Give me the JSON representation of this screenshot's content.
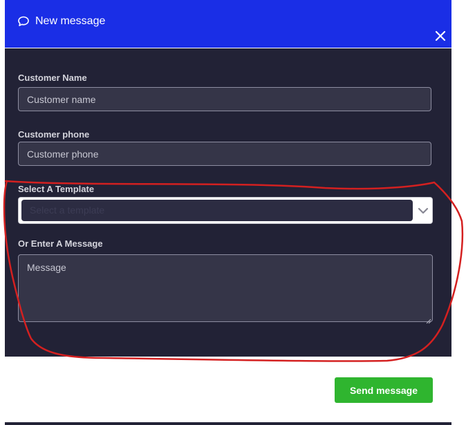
{
  "modal": {
    "title": "New message",
    "header_color": "#1a2ee6",
    "body_color": "#222236",
    "icons": {
      "title_icon": "chat-bubble-icon",
      "close_icon": "close-icon"
    }
  },
  "form": {
    "customer_name": {
      "label": "Customer Name",
      "placeholder": "Customer name",
      "value": ""
    },
    "customer_phone": {
      "label": "Customer phone",
      "placeholder": "Customer phone",
      "value": ""
    },
    "template": {
      "label": "Select A Template",
      "placeholder": "Select a template",
      "icon": "chevron-down-icon"
    },
    "message": {
      "label": "Or Enter A Message",
      "placeholder": "Message",
      "value": ""
    }
  },
  "actions": {
    "send_label": "Send message",
    "send_color": "#2fb52f"
  },
  "annotation": {
    "color": "#d42020",
    "shape": "freehand-ellipse"
  }
}
